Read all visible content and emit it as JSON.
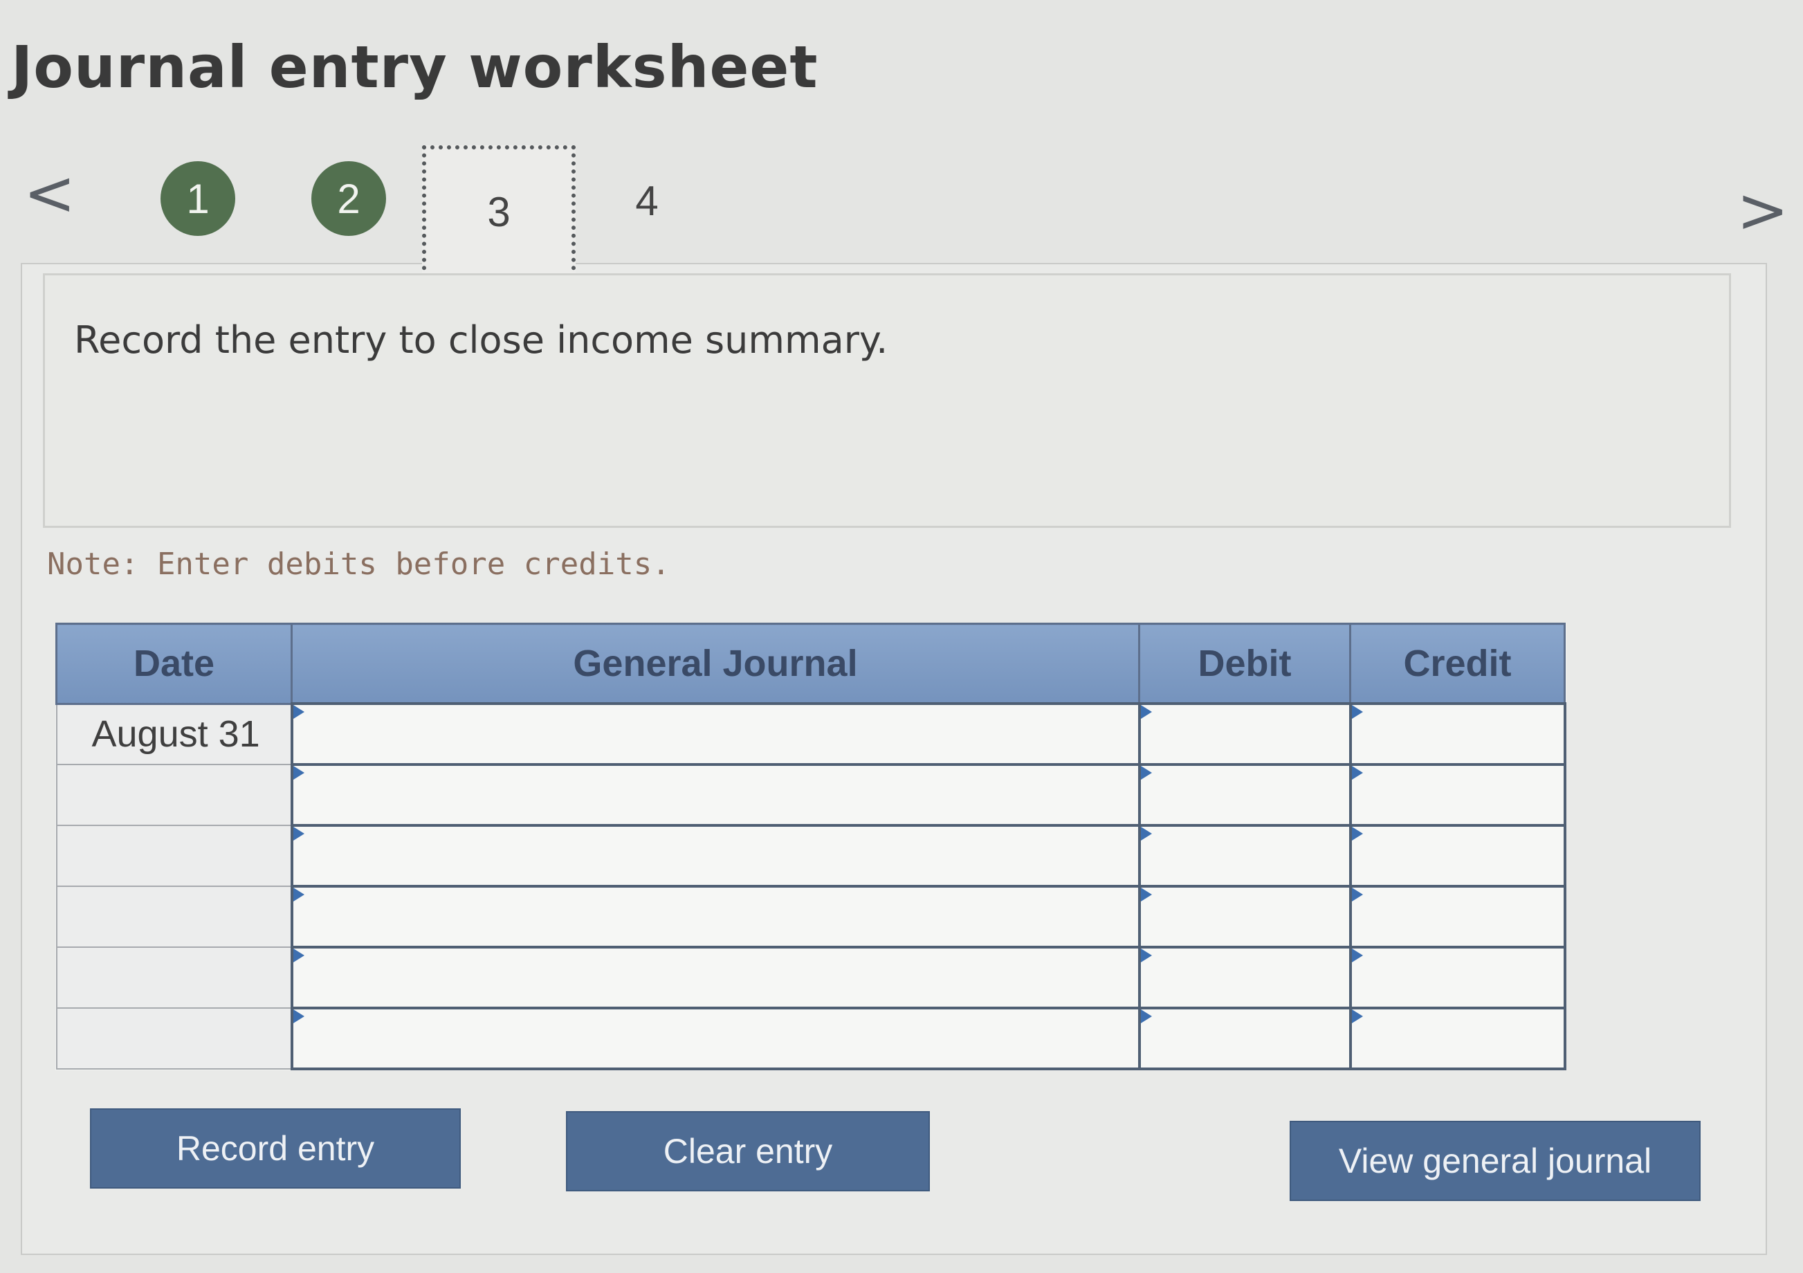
{
  "title": "Journal entry worksheet",
  "navigation": {
    "prev_icon": "chevron-left-icon",
    "next_icon": "chevron-right-icon",
    "prev_glyph": "<",
    "next_glyph": ">",
    "steps": [
      {
        "label": "1",
        "state": "completed"
      },
      {
        "label": "2",
        "state": "completed"
      },
      {
        "label": "3",
        "state": "current"
      },
      {
        "label": "4",
        "state": "pending"
      }
    ]
  },
  "instruction": "Record the entry to close income summary.",
  "note": "Note: Enter debits before credits.",
  "table": {
    "headers": {
      "date": "Date",
      "journal": "General Journal",
      "debit": "Debit",
      "credit": "Credit"
    },
    "rows": [
      {
        "date": "August 31",
        "journal": "",
        "debit": "",
        "credit": ""
      },
      {
        "date": "",
        "journal": "",
        "debit": "",
        "credit": ""
      },
      {
        "date": "",
        "journal": "",
        "debit": "",
        "credit": ""
      },
      {
        "date": "",
        "journal": "",
        "debit": "",
        "credit": ""
      },
      {
        "date": "",
        "journal": "",
        "debit": "",
        "credit": ""
      },
      {
        "date": "",
        "journal": "",
        "debit": "",
        "credit": ""
      }
    ]
  },
  "buttons": {
    "record": "Record entry",
    "clear": "Clear entry",
    "view": "View general journal"
  },
  "colors": {
    "step_completed": "#52704f",
    "header_bg": "#7f9cc5",
    "button_bg": "#4e6c94",
    "note_text": "#8a6f60"
  }
}
